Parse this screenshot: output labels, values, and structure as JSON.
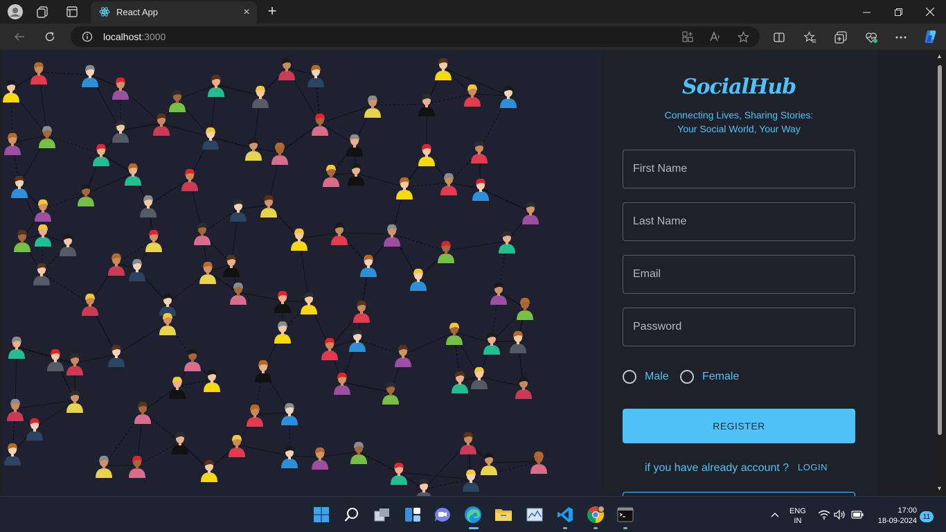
{
  "browser": {
    "tab_title": "React App",
    "new_tab_symbol": "+",
    "close_symbol": "×",
    "url_host": "localhost",
    "url_port": ":3000"
  },
  "page": {
    "brand": "SocialHub",
    "tagline_line1": "Connecting Lives, Sharing Stories:",
    "tagline_line2": "Your Social World, Your Way",
    "form": {
      "first_name_placeholder": "First Name",
      "last_name_placeholder": "Last Name",
      "email_placeholder": "Email",
      "password_placeholder": "Password",
      "gender_male": "Male",
      "gender_female": "Female",
      "register_label": "REGISTER",
      "already_text": "if you have already account ?",
      "login_label": "LOGIN"
    },
    "illustration": {
      "description_icon": "people-network-illustration",
      "colors": {
        "background": "#1f2130",
        "accent": "#4fc3f7"
      }
    }
  },
  "taskbar": {
    "language": "ENG",
    "region": "IN",
    "time": "17:00",
    "date": "18-09-2024",
    "notification_count": "11"
  }
}
